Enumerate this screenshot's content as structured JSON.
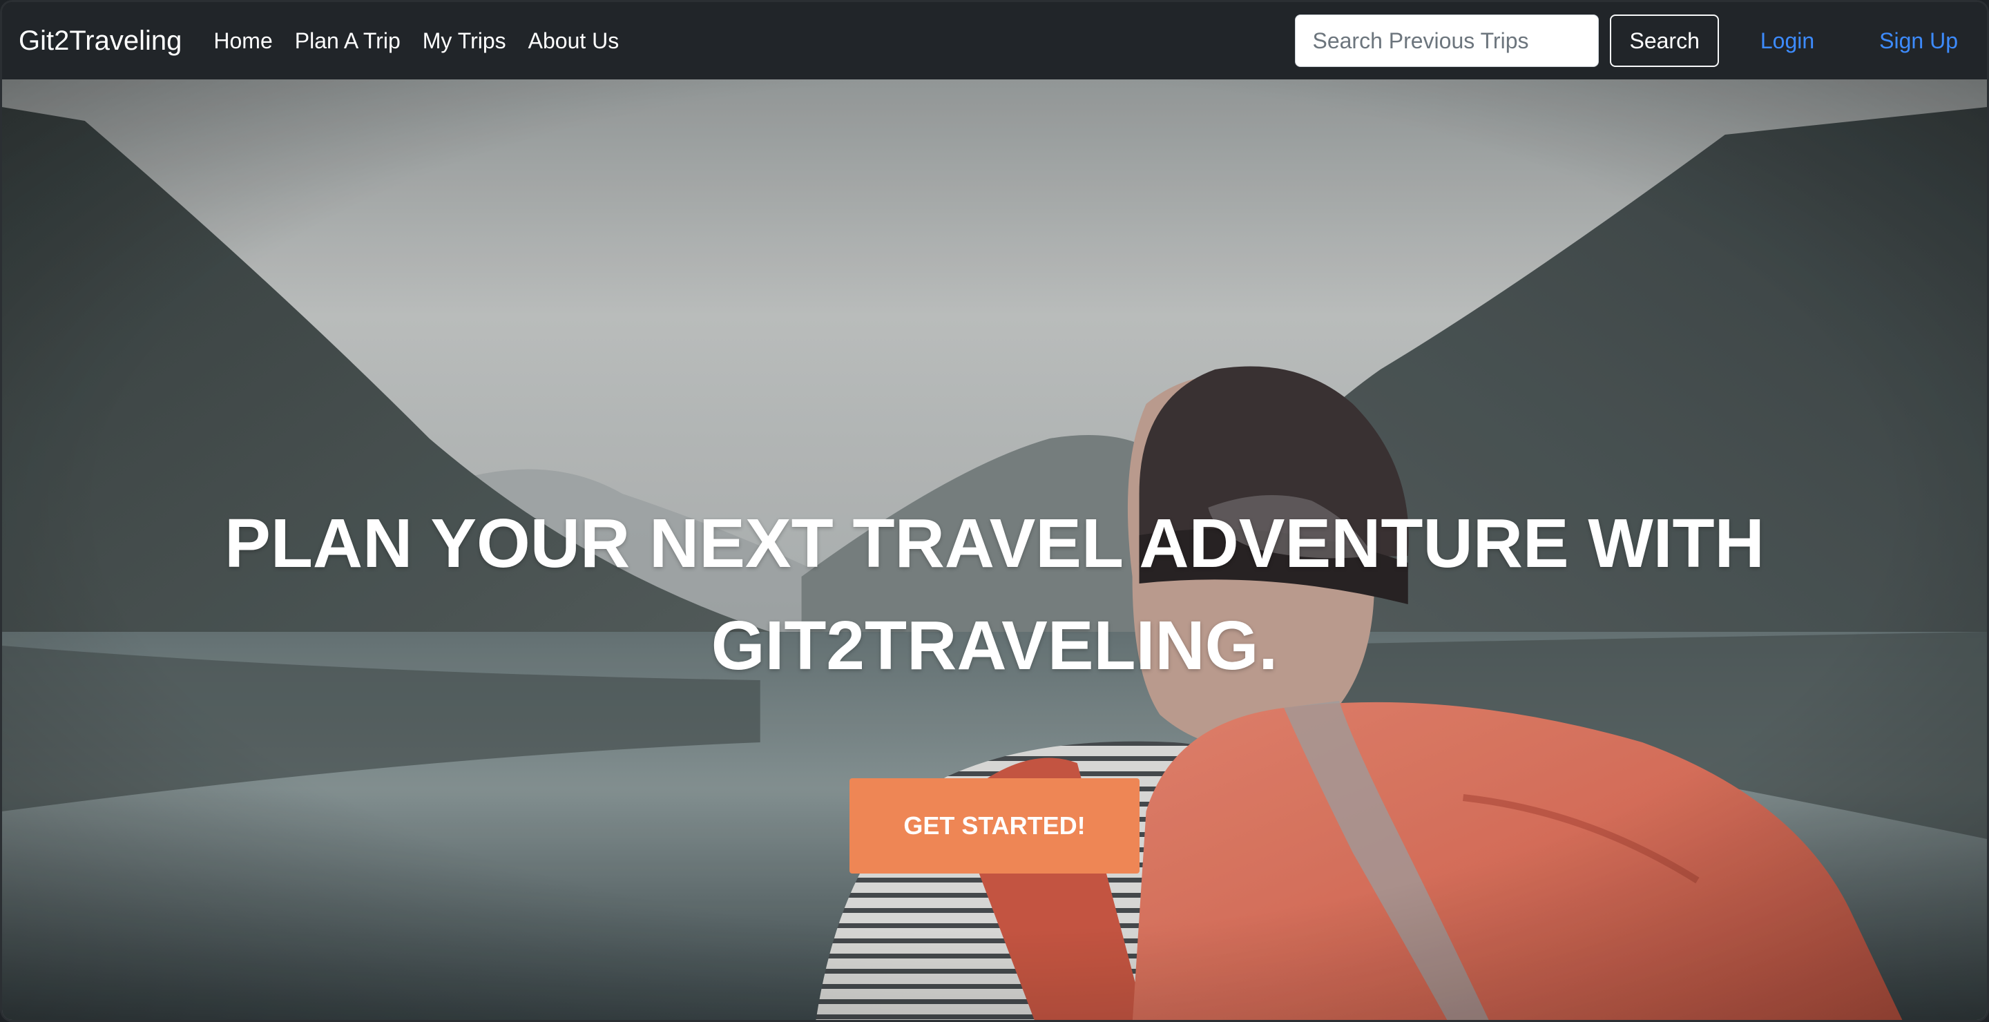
{
  "navbar": {
    "brand": "Git2Traveling",
    "links": [
      {
        "label": "Home"
      },
      {
        "label": "Plan A Trip"
      },
      {
        "label": "My Trips"
      },
      {
        "label": "About Us"
      }
    ],
    "search": {
      "placeholder": "Search Previous Trips",
      "value": "",
      "button_label": "Search"
    },
    "login_label": "Login",
    "signup_label": "Sign Up"
  },
  "hero": {
    "title": "PLAN YOUR NEXT TRAVEL ADVENTURE WITH GIT2TRAVELING.",
    "cta_label": "GET STARTED!",
    "background": "photo-backpacker-at-mountain-lake"
  },
  "colors": {
    "navbar_bg": "#212529",
    "link_blue": "#3d8bfd",
    "cta_orange": "#ee8655",
    "backpack_orange": "#e8735a"
  }
}
